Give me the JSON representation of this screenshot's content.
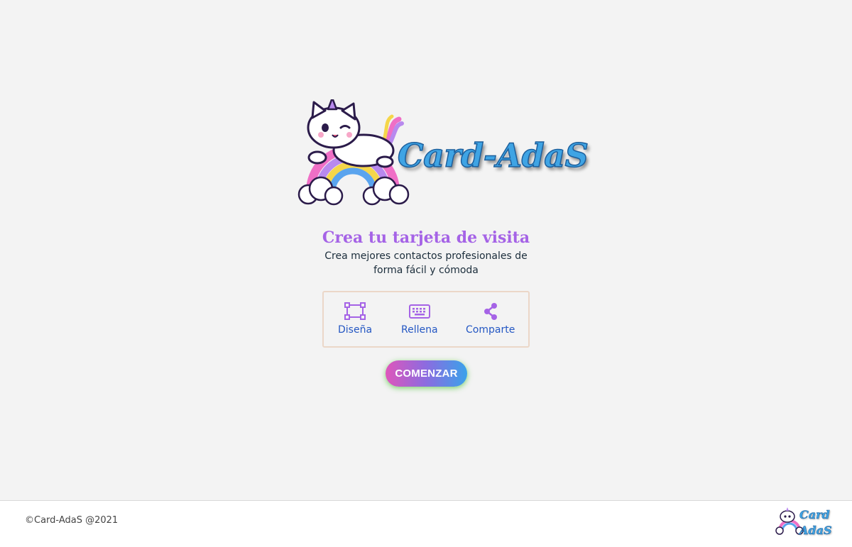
{
  "hero": {
    "brand_name": "Card-AdaS",
    "title": "Crea tu tarjeta de visita",
    "subtitle": "Crea mejores contactos profesionales de forma fácil y cómoda"
  },
  "steps": [
    {
      "label": "Diseña",
      "icon": "design-icon"
    },
    {
      "label": "Rellena",
      "icon": "keyboard-icon"
    },
    {
      "label": "Comparte",
      "icon": "share-icon"
    }
  ],
  "cta": {
    "label": "COMENZAR"
  },
  "footer": {
    "copyright": "©Card-AdaS @2021",
    "logo_line1": "Card",
    "logo_line2": "AdaS"
  },
  "colors": {
    "background": "#f3f3f3",
    "title": "#a563e6",
    "step_label": "#2457c3",
    "brand_blue": "#3fa4e4",
    "cta_gradient_start": "#de56bb",
    "cta_gradient_end": "#3aa2ea"
  }
}
